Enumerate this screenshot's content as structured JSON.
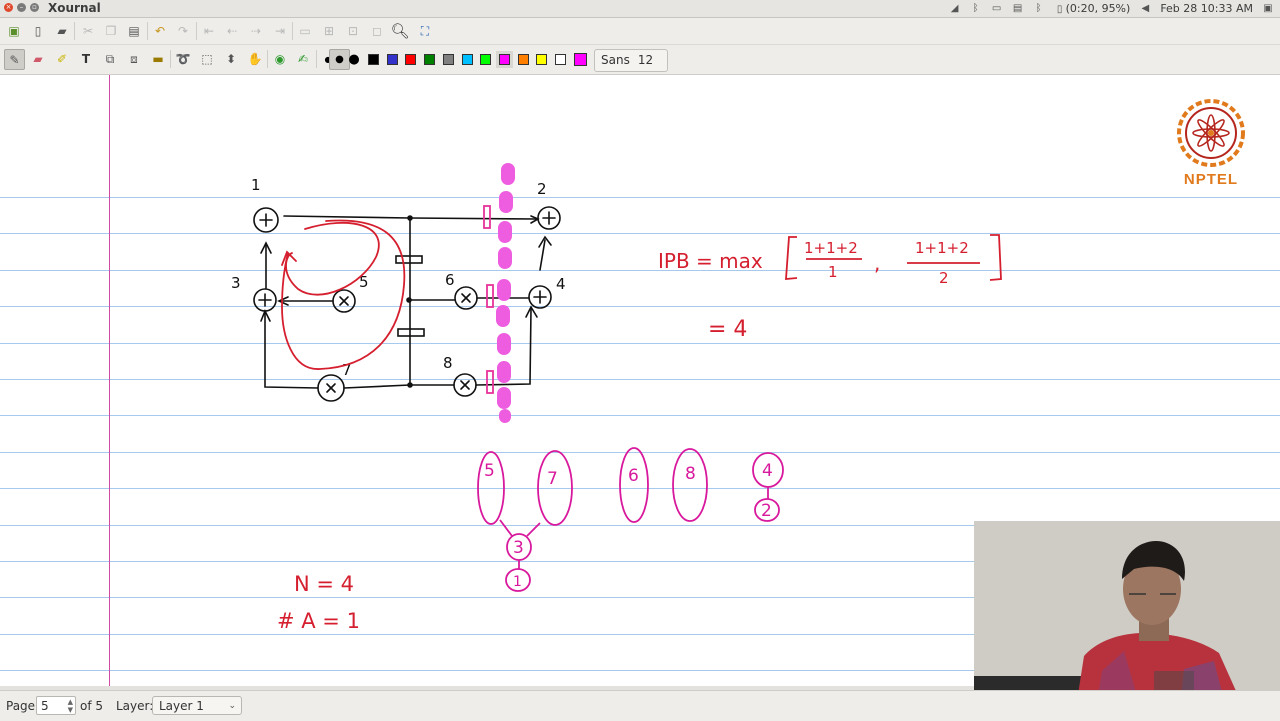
{
  "window": {
    "title": "Xournal"
  },
  "tray": {
    "battery": "(0:20, 95%)",
    "datetime": "Feb 28 10:33 AM"
  },
  "toolbar": {
    "font_name": "Sans",
    "font_size": "12",
    "colors": [
      "#000000",
      "#3333cc",
      "#ff0000",
      "#008000",
      "#808080",
      "#00c0ff",
      "#00ff00",
      "#ff00ff",
      "#ff8000",
      "#ffff00",
      "#ffffff"
    ],
    "active_color": "#ff00ff"
  },
  "logo": {
    "text": "NPTEL"
  },
  "board": {
    "node_labels": [
      "1",
      "2",
      "3",
      "4",
      "5",
      "6",
      "7",
      "8"
    ],
    "ipb_lhs": "IPB = max",
    "frac1_num": "1+1+2",
    "frac1_den": "1",
    "frac_sep": ",",
    "frac2_num": "1+1+2",
    "frac2_den": "2",
    "result": "=   4",
    "tree_nodes": [
      "5",
      "7",
      "6",
      "8",
      "4",
      "2",
      "3",
      "1"
    ],
    "n_eq": "N =  4",
    "a_eq": "#  A  =  1"
  },
  "status": {
    "page_label": "Page",
    "page_value": "5",
    "of_label": "of 5",
    "layer_label": "Layer:",
    "layer_value": "Layer 1"
  }
}
